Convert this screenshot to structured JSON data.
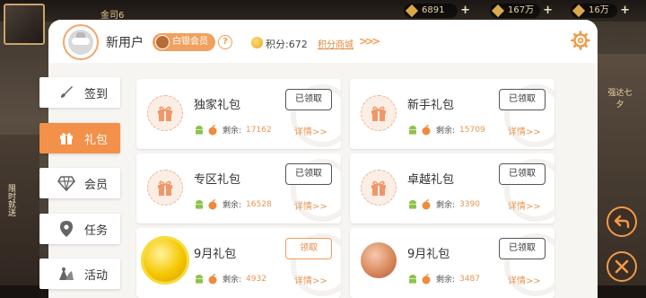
{
  "game": {
    "level_text": "金司6",
    "resources": [
      "6891",
      "167万",
      "16万"
    ],
    "left_text": "限时就送",
    "right_text": "强达七夕"
  },
  "header": {
    "user_name": "新用户",
    "vip_label": "白银会员",
    "help": "?",
    "points": "积分:672",
    "mall_link": "积分商城",
    "mall_arrows": ">>>"
  },
  "nav": [
    {
      "label": "签到",
      "icon": "brush-icon"
    },
    {
      "label": "礼包",
      "icon": "gift-icon",
      "active": true
    },
    {
      "label": "会员",
      "icon": "diamond-icon"
    },
    {
      "label": "任务",
      "icon": "location-pin-icon"
    },
    {
      "label": "活动",
      "icon": "activity-icon"
    }
  ],
  "cards": [
    {
      "title": "独家礼包",
      "remain_label": "剩余:",
      "remain": "17162",
      "details": "详情>>",
      "button": "已领取",
      "button_state": "claimed",
      "icon": "gift-icon"
    },
    {
      "title": "新手礼包",
      "remain_label": "剩余:",
      "remain": "15709",
      "details": "详情>>",
      "button": "已领取",
      "button_state": "claimed",
      "icon": "gift-icon"
    },
    {
      "title": "专区礼包",
      "remain_label": "剩余:",
      "remain": "16528",
      "details": "详情>>",
      "button": "已领取",
      "button_state": "claimed",
      "icon": "gift-icon"
    },
    {
      "title": "卓越礼包",
      "remain_label": "剩余:",
      "remain": "3390",
      "details": "详情>>",
      "button": "已领取",
      "button_state": "claimed",
      "icon": "gift-icon"
    },
    {
      "title": "9月礼包",
      "remain_label": "剩余:",
      "remain": "4932",
      "details": "详情>>",
      "button": "领取",
      "button_state": "open",
      "icon": "gold-medal-icon"
    },
    {
      "title": "9月礼包",
      "remain_label": "剩余:",
      "remain": "3487",
      "details": "详情>>",
      "button": "已领取",
      "button_state": "claimed",
      "icon": "bronze-medal-icon"
    }
  ],
  "colors": {
    "accent": "#f39049",
    "remain": "#e49752",
    "android": "#8cc34a",
    "apple": "#f08a3c"
  }
}
